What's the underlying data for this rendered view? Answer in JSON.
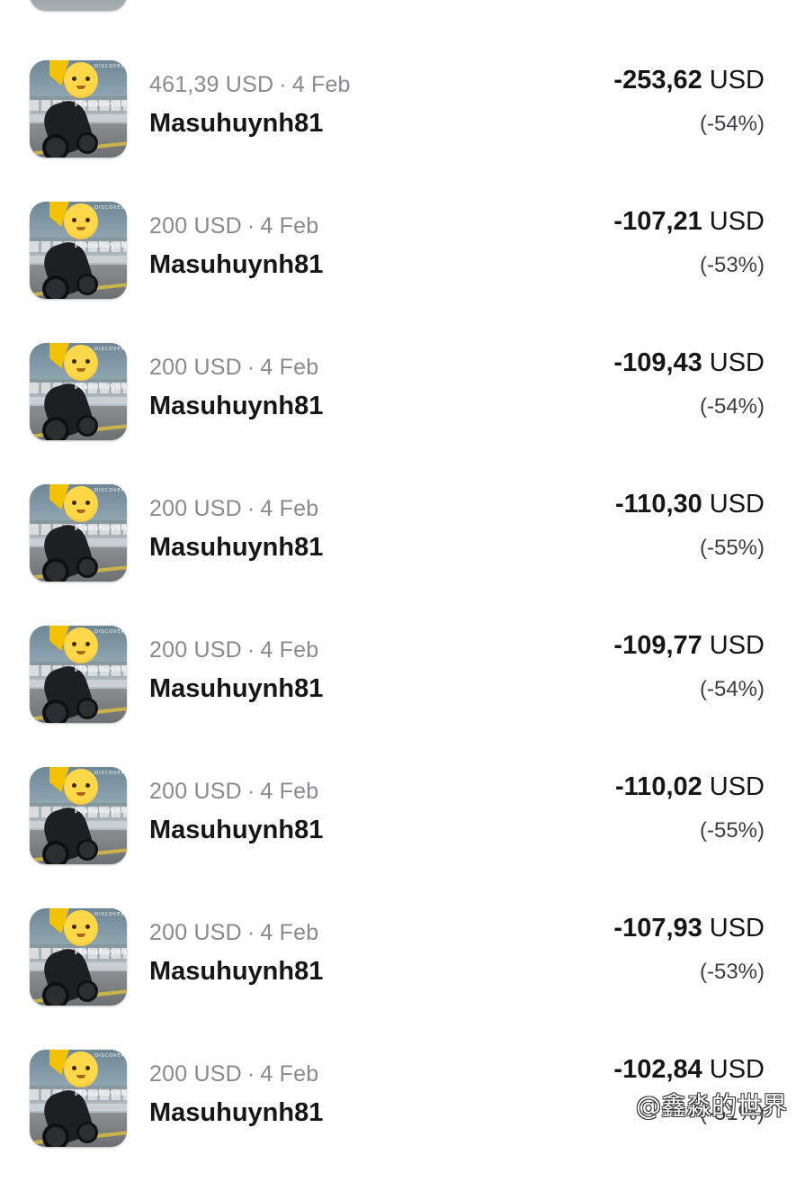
{
  "transactions": [
    {
      "name": "Masuhuynh81",
      "amount": "461,39 USD",
      "date": "4 Feb",
      "change": "-253,62",
      "currency": "USD",
      "percent": "(-54%)"
    },
    {
      "name": "Masuhuynh81",
      "amount": "200 USD",
      "date": "4 Feb",
      "change": "-107,21",
      "currency": "USD",
      "percent": "(-53%)"
    },
    {
      "name": "Masuhuynh81",
      "amount": "200 USD",
      "date": "4 Feb",
      "change": "-109,43",
      "currency": "USD",
      "percent": "(-54%)"
    },
    {
      "name": "Masuhuynh81",
      "amount": "200 USD",
      "date": "4 Feb",
      "change": "-110,30",
      "currency": "USD",
      "percent": "(-55%)"
    },
    {
      "name": "Masuhuynh81",
      "amount": "200 USD",
      "date": "4 Feb",
      "change": "-109,77",
      "currency": "USD",
      "percent": "(-54%)"
    },
    {
      "name": "Masuhuynh81",
      "amount": "200 USD",
      "date": "4 Feb",
      "change": "-110,02",
      "currency": "USD",
      "percent": "(-55%)"
    },
    {
      "name": "Masuhuynh81",
      "amount": "200 USD",
      "date": "4 Feb",
      "change": "-107,93",
      "currency": "USD",
      "percent": "(-53%)"
    },
    {
      "name": "Masuhuynh81",
      "amount": "200 USD",
      "date": "4 Feb",
      "change": "-102,84",
      "currency": "USD",
      "percent": "(-51%)"
    }
  ],
  "separator": "·",
  "thumbnail": {
    "tag": "DISCOVER",
    "watermark": "Masuhuynh"
  },
  "credit": "@鑫淼的世界"
}
